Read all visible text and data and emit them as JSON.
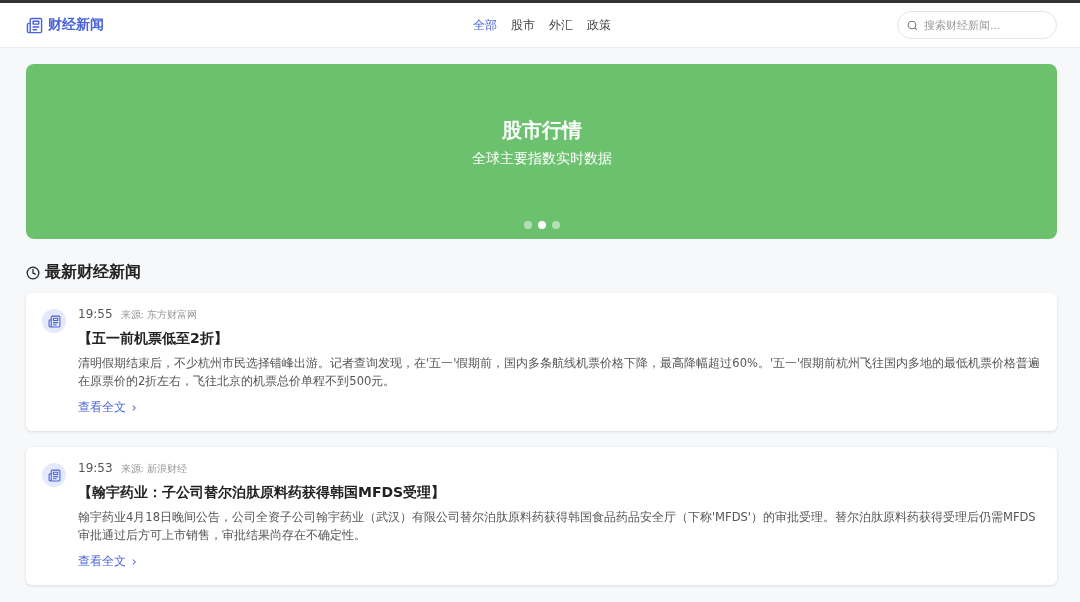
{
  "header": {
    "logo": "财经新闻",
    "nav": [
      {
        "label": "全部",
        "selected": true
      },
      {
        "label": "股市",
        "selected": false
      },
      {
        "label": "外汇",
        "selected": false
      },
      {
        "label": "政策",
        "selected": false
      }
    ],
    "search": {
      "placeholder": "搜索财经新闻..."
    }
  },
  "banner": {
    "title": "股市行情",
    "subtitle": "全球主要指数实时数据",
    "dots": [
      {
        "selected": false
      },
      {
        "selected": true
      },
      {
        "selected": false
      }
    ]
  },
  "section": {
    "title": "最新财经新闻"
  },
  "news": [
    {
      "time": "19:55",
      "source": "来源: 东方财富网",
      "title": "【五一前机票低至2折】",
      "summary": "清明假期结束后，不少杭州市民选择错峰出游。记者查询发现，在'五一'假期前，国内多条航线机票价格下降，最高降幅超过60%。'五一'假期前杭州飞往国内多地的最低机票价格普遍在原票价的2折左右，飞往北京的机票总价单程不到500元。",
      "link": "查看全文"
    },
    {
      "time": "19:53",
      "source": "来源: 新浪财经",
      "title": "【翰宇药业：子公司替尔泊肽原料药获得韩国MFDS受理】",
      "summary": "翰宇药业4月18日晚间公告，公司全资子公司翰宇药业（武汉）有限公司替尔泊肽原料药获得韩国食品药品安全厅（下称'MFDS'）的审批受理。替尔泊肽原料药获得受理后仍需MFDS审批通过后方可上市销售，审批结果尚存在不确定性。",
      "link": "查看全文"
    }
  ]
}
